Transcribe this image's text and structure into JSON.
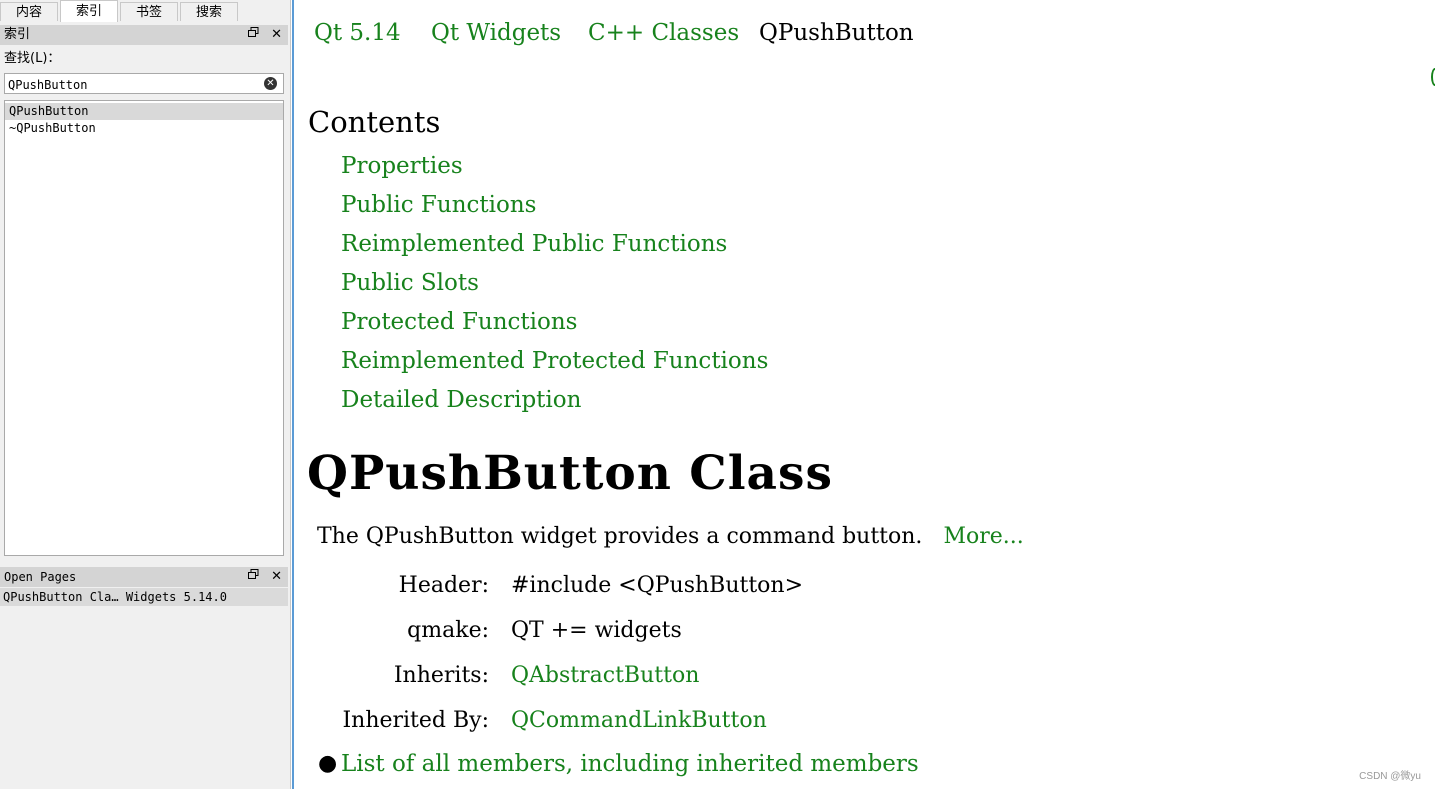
{
  "left_panel": {
    "tabs": [
      "内容",
      "索引",
      "书签",
      "搜索"
    ],
    "active_tab_index": 1,
    "index_dock": {
      "title": "索引",
      "float_icon": "restore-icon",
      "close_icon": "close-icon"
    },
    "find_label": "查找(L)：",
    "search": {
      "value": "QPushButton",
      "clear_icon": "clear-circle-icon"
    },
    "index_items": [
      "QPushButton",
      "~QPushButton"
    ],
    "selected_index_item": 0,
    "open_pages_dock": {
      "title": "Open Pages",
      "items": [
        "QPushButton Cla… Widgets 5.14.0"
      ]
    }
  },
  "content": {
    "breadcrumb": [
      "Qt 5.14",
      "Qt Widgets",
      "C++ Classes",
      "QPushButton"
    ],
    "contents_heading": "Contents",
    "toc": [
      "Properties",
      "Public Functions",
      "Reimplemented Public Functions",
      "Public Slots",
      "Protected Functions",
      "Reimplemented Protected Functions",
      "Detailed Description"
    ],
    "class_title": "QPushButton Class",
    "brief": "The QPushButton widget provides a command button.",
    "more_link": "More...",
    "info": [
      {
        "label": "Header:",
        "value": "#include <QPushButton>",
        "is_link": false
      },
      {
        "label": "qmake:",
        "value": "QT += widgets",
        "is_link": false
      },
      {
        "label": "Inherits:",
        "value": "QAbstractButton",
        "is_link": true
      },
      {
        "label": "Inherited By:",
        "value": "QCommandLinkButton",
        "is_link": true
      }
    ],
    "members_link": "List of all members, including inherited members"
  },
  "watermark": "CSDN @微yu",
  "colors": {
    "link": "#17821c",
    "panel_bg": "#f0f0f0",
    "accent_border": "#5b9bd5"
  }
}
